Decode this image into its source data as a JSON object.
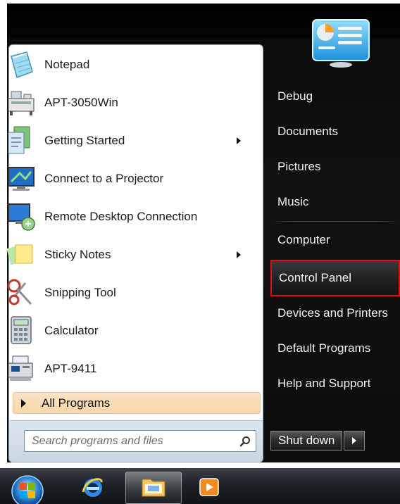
{
  "programs": [
    {
      "label": "Notepad",
      "icon": "notepad-icon",
      "has_submenu": false
    },
    {
      "label": "APT-3050Win",
      "icon": "machine-icon",
      "has_submenu": false
    },
    {
      "label": "Getting Started",
      "icon": "getting-started-icon",
      "has_submenu": true
    },
    {
      "label": "Connect to a Projector",
      "icon": "projector-icon",
      "has_submenu": false
    },
    {
      "label": "Remote Desktop Connection",
      "icon": "remote-desktop-icon",
      "has_submenu": false
    },
    {
      "label": "Sticky Notes",
      "icon": "sticky-notes-icon",
      "has_submenu": true
    },
    {
      "label": "Snipping Tool",
      "icon": "scissors-icon",
      "has_submenu": false
    },
    {
      "label": "Calculator",
      "icon": "calculator-icon",
      "has_submenu": false
    },
    {
      "label": "APT-9411",
      "icon": "printer-machine-icon",
      "has_submenu": false
    }
  ],
  "all_programs_label": "All Programs",
  "search": {
    "placeholder": "Search programs and files"
  },
  "right_items": [
    {
      "label": "Debug"
    },
    {
      "label": "Documents"
    },
    {
      "label": "Pictures"
    },
    {
      "label": "Music"
    },
    {
      "label": "Computer"
    },
    {
      "label": "Control Panel",
      "highlighted": true
    },
    {
      "label": "Devices and Printers"
    },
    {
      "label": "Default Programs"
    },
    {
      "label": "Help and Support"
    }
  ],
  "shutdown_label": "Shut down",
  "colors": {
    "highlight_border": "#e01010",
    "all_programs_bg": "#f8d7aa"
  }
}
